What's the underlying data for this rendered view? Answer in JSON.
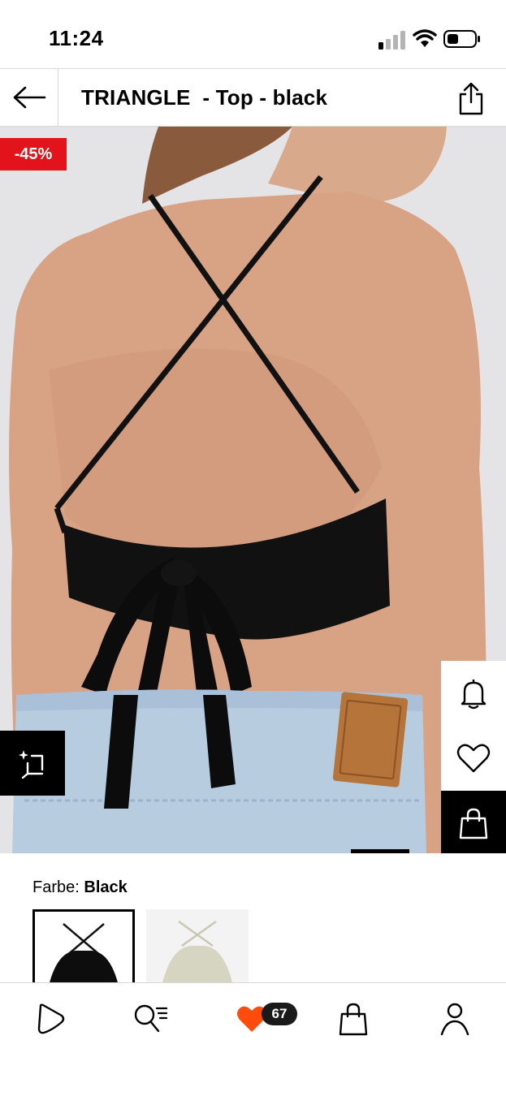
{
  "status_bar": {
    "time": "11:24",
    "signal_icon": "cellular-signal-icon",
    "wifi_icon": "wifi-icon",
    "battery_icon": "battery-icon"
  },
  "header": {
    "back_icon": "arrow-left-icon",
    "title": "TRIANGLE  - Top - black",
    "share_icon": "share-icon"
  },
  "product": {
    "discount_badge": "-45%",
    "ai_icon": "sparkle-crop-icon",
    "side_actions": [
      {
        "icon": "bell-icon"
      },
      {
        "icon": "heart-icon"
      },
      {
        "icon": "shopping-bag-icon"
      }
    ],
    "image_subject": "back view of black cross-strap tie-back top with light blue jeans"
  },
  "color": {
    "label": "Farbe:",
    "value": "Black",
    "swatches": [
      {
        "color": "#0d0d0d",
        "selected": true
      },
      {
        "color": "#d6d5c2",
        "selected": false
      }
    ]
  },
  "tab_bar": {
    "items": [
      {
        "icon": "home-play-icon"
      },
      {
        "icon": "search-list-icon"
      },
      {
        "icon": "heart-filled-icon"
      },
      {
        "icon": "shopping-bag-icon"
      },
      {
        "icon": "user-icon"
      }
    ],
    "favorites_count": "67"
  },
  "colors": {
    "accent": "#e2131a",
    "favorite_heart": "#ff4b0b",
    "badge_bg": "#1a1a1a"
  }
}
